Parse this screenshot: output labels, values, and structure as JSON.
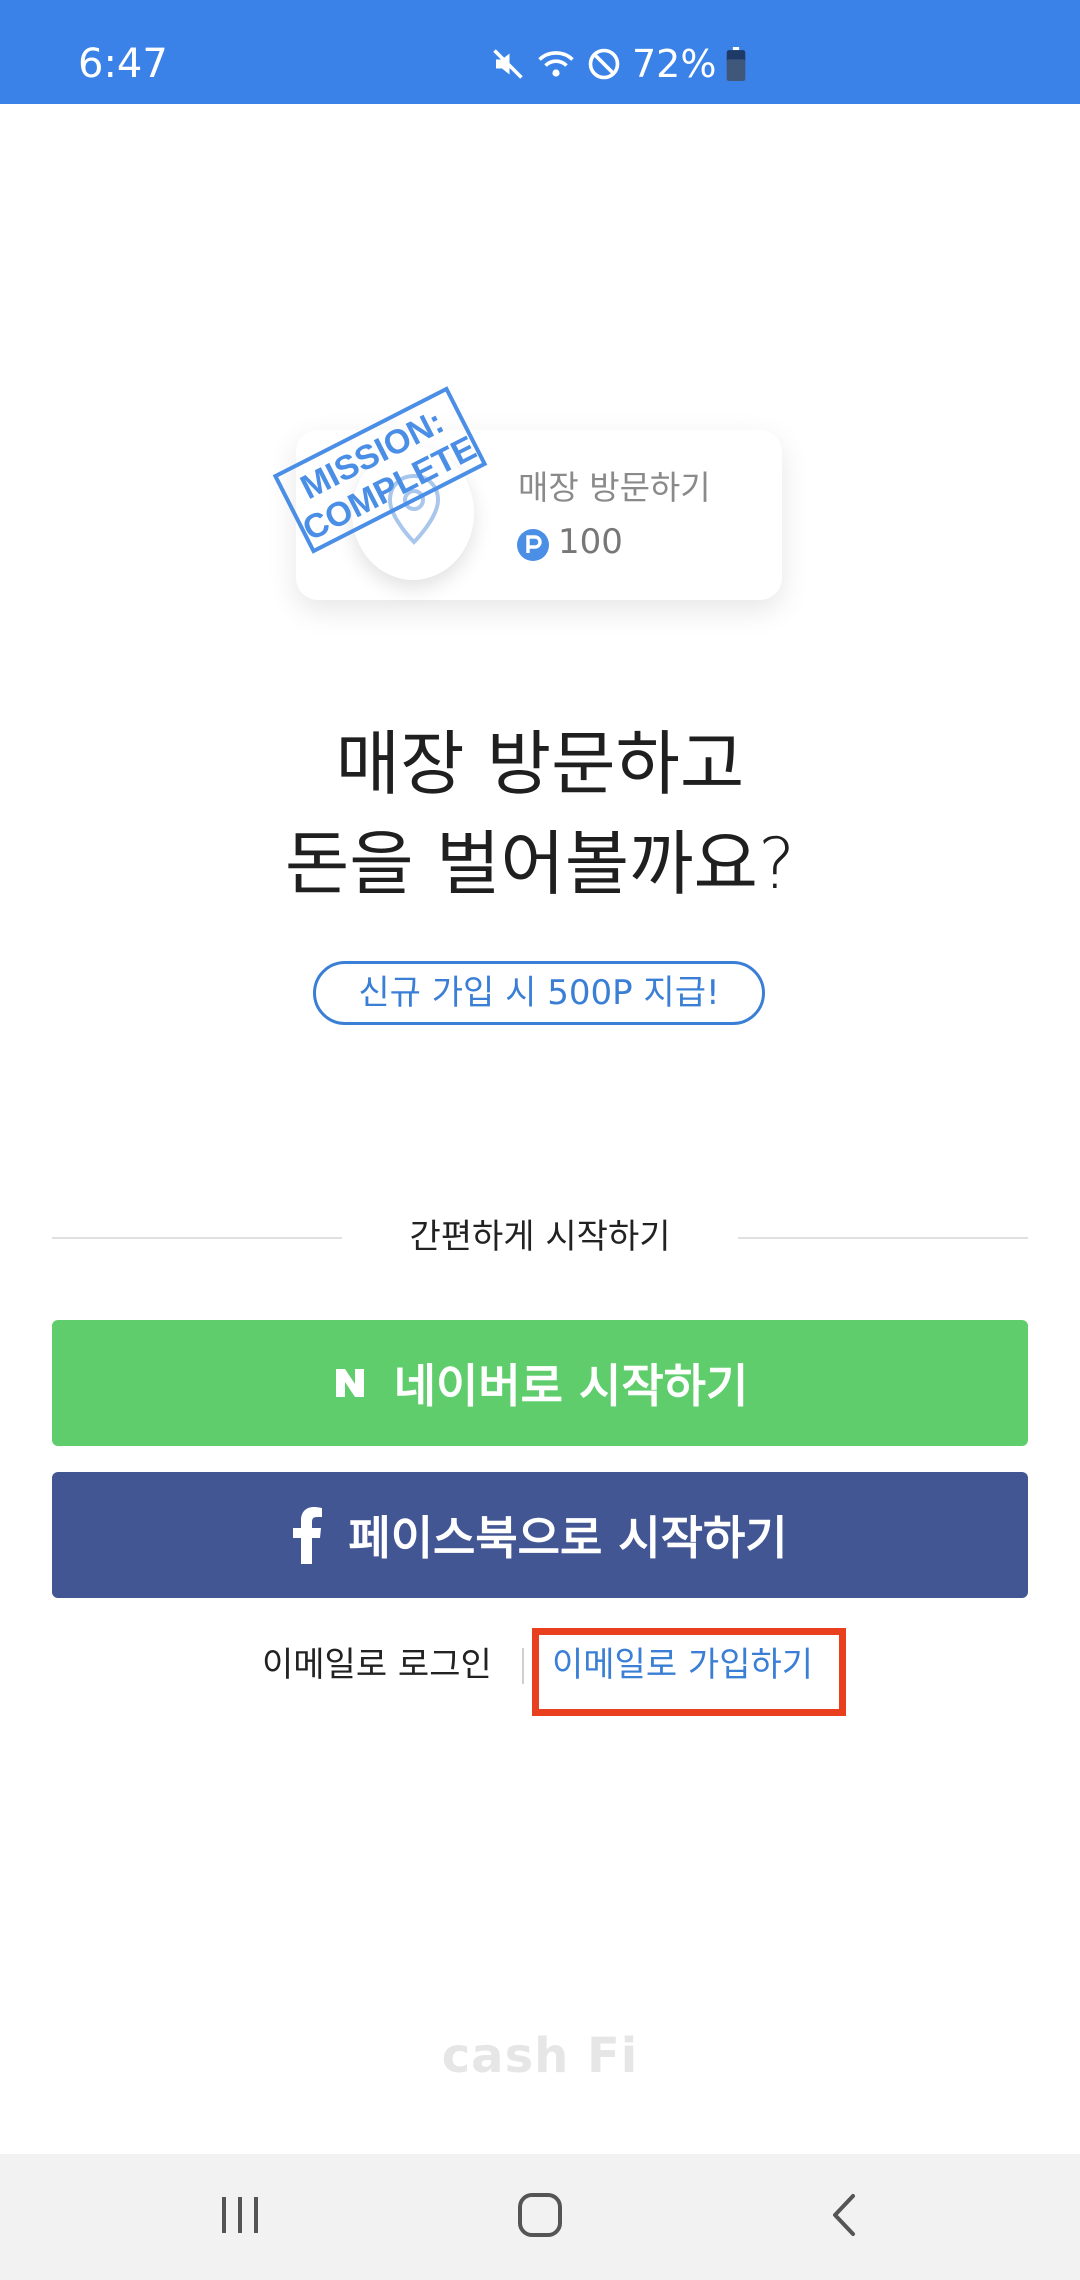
{
  "status_bar": {
    "time": "6:47",
    "battery_percent": "72%",
    "icons": [
      "mute-icon",
      "wifi-icon",
      "do-not-disturb-icon",
      "battery-icon"
    ],
    "background": "#3a82e8"
  },
  "mission_card": {
    "title": "매장 방문하기",
    "points": "100",
    "stamp_text_line1": "MISSION:",
    "stamp_text_line2": "COMPLETE",
    "icon": "location-pin-icon",
    "point_icon": "point-coin-icon"
  },
  "headline": {
    "line1": "매장 방문하고",
    "line2": "돈을 벌어볼까요?"
  },
  "bonus_badge": "신규 가입 시 500P 지급!",
  "divider_label": "간편하게 시작하기",
  "buttons": {
    "naver": {
      "label": "네이버로 시작하기",
      "icon": "naver-icon",
      "color": "#5fcd6c"
    },
    "facebook": {
      "label": "페이스북으로 시작하기",
      "icon": "facebook-icon",
      "color": "#435694"
    }
  },
  "email_links": {
    "login": "이메일로 로그인",
    "signup": "이메일로 가입하기",
    "highlight_color": "#e8401f",
    "link_color": "#3a7fd5"
  },
  "brand": "cash Fi",
  "nav_bar": {
    "icons": [
      "recents-icon",
      "home-icon",
      "back-icon"
    ]
  }
}
